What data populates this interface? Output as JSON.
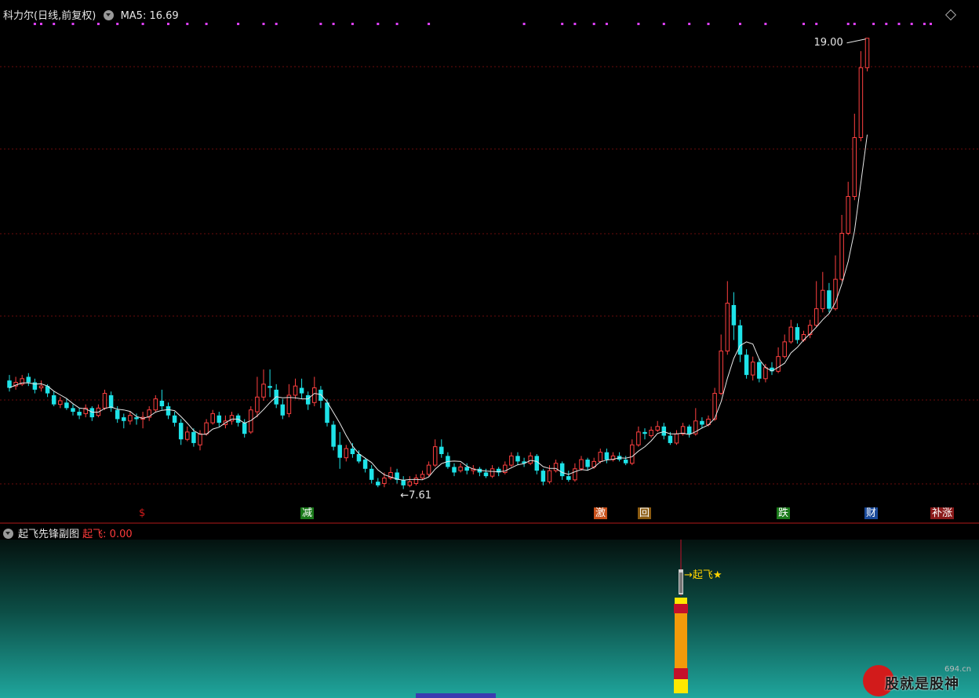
{
  "header": {
    "stock_name": "科力尔(日线,前复权)",
    "ma_label": "MA5: 16.69"
  },
  "sub_header": {
    "title": "起飞先锋副图",
    "value_label": "起飞: 0.00"
  },
  "annotations": {
    "high_label": "19.00",
    "low_label": "←7.61",
    "liftoff_label": "→起飞★"
  },
  "markers": [
    {
      "text": "$",
      "color": "#d21b1b",
      "bg": "#000000"
    },
    {
      "text": "减",
      "color": "#ffffff",
      "bg": "#1a7a1a"
    },
    {
      "text": "激",
      "color": "#ffffff",
      "bg": "#c8501a"
    },
    {
      "text": "回",
      "color": "#ffffff",
      "bg": "#8a5a10"
    },
    {
      "text": "跌",
      "color": "#ffffff",
      "bg": "#1a7a1a"
    },
    {
      "text": "财",
      "color": "#ffffff",
      "bg": "#1a4a9a"
    },
    {
      "text": "补涨",
      "color": "#ffffff",
      "bg": "#8a1a1a"
    }
  ],
  "watermark": {
    "brand": "股就是股神",
    "site": "694.cn"
  },
  "colors": {
    "up": "#ff4040",
    "down": "#1ee3e8",
    "ma": "#e8e8e8",
    "signal_dot": "#e040ff",
    "grid": "#6b0d0d"
  },
  "chart_data": {
    "type": "candlestick",
    "title": "科力尔(日线,前复权)",
    "ylim": [
      6.4,
      19.4
    ],
    "grid": true,
    "highest": 19.0,
    "lowest": 7.61,
    "ma5_last": 16.69,
    "candles": [
      [
        9.7,
        9.5,
        9.85,
        9.4
      ],
      [
        9.55,
        9.65,
        9.8,
        9.45
      ],
      [
        9.6,
        9.75,
        9.85,
        9.55
      ],
      [
        9.8,
        9.65,
        9.9,
        9.55
      ],
      [
        9.65,
        9.45,
        9.75,
        9.35
      ],
      [
        9.5,
        9.55,
        9.7,
        9.4
      ],
      [
        9.55,
        9.35,
        9.6,
        9.25
      ],
      [
        9.3,
        9.05,
        9.4,
        9.0
      ],
      [
        9.05,
        9.15,
        9.25,
        8.95
      ],
      [
        9.1,
        8.95,
        9.2,
        8.9
      ],
      [
        8.95,
        8.85,
        9.05,
        8.75
      ],
      [
        8.85,
        8.75,
        8.95,
        8.65
      ],
      [
        8.8,
        8.95,
        9.05,
        8.7
      ],
      [
        8.95,
        8.7,
        9.0,
        8.6
      ],
      [
        8.75,
        8.95,
        9.05,
        8.7
      ],
      [
        8.95,
        9.35,
        9.45,
        8.9
      ],
      [
        9.3,
        8.95,
        9.4,
        8.85
      ],
      [
        8.9,
        8.65,
        9.0,
        8.55
      ],
      [
        8.7,
        8.6,
        8.8,
        8.4
      ],
      [
        8.6,
        8.75,
        8.85,
        8.5
      ],
      [
        8.7,
        8.65,
        8.8,
        8.5
      ],
      [
        8.65,
        8.7,
        8.85,
        8.4
      ],
      [
        8.7,
        8.9,
        9.0,
        8.6
      ],
      [
        8.9,
        9.2,
        9.3,
        8.85
      ],
      [
        9.15,
        9.0,
        9.45,
        8.9
      ],
      [
        9.0,
        8.75,
        9.1,
        8.65
      ],
      [
        8.75,
        8.55,
        8.85,
        8.45
      ],
      [
        8.55,
        8.1,
        8.65,
        7.95
      ],
      [
        8.1,
        8.3,
        8.45,
        8.05
      ],
      [
        8.3,
        8.0,
        8.4,
        7.9
      ],
      [
        7.95,
        8.25,
        8.35,
        7.8
      ],
      [
        8.25,
        8.55,
        8.65,
        8.2
      ],
      [
        8.55,
        8.8,
        8.9,
        8.5
      ],
      [
        8.75,
        8.55,
        8.85,
        8.45
      ],
      [
        8.5,
        8.6,
        8.75,
        8.4
      ],
      [
        8.6,
        8.75,
        8.85,
        8.5
      ],
      [
        8.75,
        8.55,
        8.8,
        8.45
      ],
      [
        8.55,
        8.25,
        8.65,
        8.15
      ],
      [
        8.3,
        8.9,
        9.0,
        8.25
      ],
      [
        8.85,
        9.25,
        9.8,
        8.7
      ],
      [
        9.25,
        9.6,
        10.0,
        9.15
      ],
      [
        9.55,
        9.5,
        10.0,
        9.25
      ],
      [
        9.45,
        9.05,
        9.6,
        8.95
      ],
      [
        9.05,
        8.75,
        9.2,
        8.65
      ],
      [
        8.8,
        9.3,
        9.6,
        8.7
      ],
      [
        9.3,
        9.55,
        9.75,
        9.2
      ],
      [
        9.5,
        9.35,
        9.75,
        9.2
      ],
      [
        9.3,
        9.05,
        9.4,
        8.9
      ],
      [
        9.1,
        9.5,
        9.8,
        9.0
      ],
      [
        9.45,
        9.15,
        9.55,
        8.95
      ],
      [
        9.1,
        8.55,
        9.2,
        8.45
      ],
      [
        8.5,
        7.9,
        8.6,
        7.8
      ],
      [
        7.95,
        7.6,
        8.3,
        7.3
      ],
      [
        7.6,
        7.85,
        7.95,
        7.5
      ],
      [
        7.85,
        7.7,
        8.0,
        7.6
      ],
      [
        7.7,
        7.5,
        7.8,
        7.45
      ],
      [
        7.55,
        7.3,
        7.6,
        7.2
      ],
      [
        7.3,
        7.0,
        7.4,
        6.9
      ],
      [
        6.95,
        6.85,
        7.05,
        6.8
      ],
      [
        6.9,
        7.05,
        7.2,
        6.8
      ],
      [
        7.05,
        7.2,
        7.35,
        7.0
      ],
      [
        7.2,
        7.0,
        7.3,
        6.9
      ],
      [
        7.0,
        6.85,
        7.1,
        6.75
      ],
      [
        6.85,
        6.95,
        7.1,
        6.8
      ],
      [
        6.9,
        7.05,
        7.15,
        6.85
      ],
      [
        7.05,
        7.15,
        7.25,
        7.0
      ],
      [
        7.15,
        7.4,
        7.5,
        7.1
      ],
      [
        7.4,
        7.9,
        8.1,
        7.35
      ],
      [
        7.9,
        7.7,
        8.1,
        7.6
      ],
      [
        7.65,
        7.35,
        7.75,
        7.3
      ],
      [
        7.35,
        7.2,
        7.45,
        7.1
      ],
      [
        7.25,
        7.35,
        7.45,
        7.2
      ],
      [
        7.35,
        7.25,
        7.45,
        7.15
      ],
      [
        7.25,
        7.3,
        7.4,
        7.15
      ],
      [
        7.3,
        7.2,
        7.35,
        7.1
      ],
      [
        7.2,
        7.1,
        7.3,
        7.05
      ],
      [
        7.1,
        7.3,
        7.4,
        7.05
      ],
      [
        7.3,
        7.2,
        7.35,
        7.1
      ],
      [
        7.2,
        7.4,
        7.5,
        7.15
      ],
      [
        7.4,
        7.65,
        7.75,
        7.35
      ],
      [
        7.65,
        7.5,
        7.75,
        7.4
      ],
      [
        7.5,
        7.45,
        7.6,
        7.35
      ],
      [
        7.45,
        7.65,
        7.75,
        7.4
      ],
      [
        7.65,
        7.25,
        7.7,
        7.15
      ],
      [
        7.25,
        6.95,
        7.3,
        6.85
      ],
      [
        6.95,
        7.25,
        7.4,
        6.9
      ],
      [
        7.25,
        7.45,
        7.55,
        7.2
      ],
      [
        7.45,
        7.1,
        7.5,
        7.0
      ],
      [
        7.1,
        7.0,
        7.25,
        6.95
      ],
      [
        7.0,
        7.3,
        7.45,
        6.95
      ],
      [
        7.3,
        7.55,
        7.65,
        7.25
      ],
      [
        7.55,
        7.35,
        7.6,
        7.25
      ],
      [
        7.35,
        7.5,
        7.6,
        7.3
      ],
      [
        7.5,
        7.75,
        7.85,
        7.45
      ],
      [
        7.75,
        7.55,
        7.85,
        7.45
      ],
      [
        7.55,
        7.65,
        7.75,
        7.5
      ],
      [
        7.65,
        7.55,
        7.75,
        7.5
      ],
      [
        7.55,
        7.45,
        7.65,
        7.4
      ],
      [
        7.45,
        7.95,
        8.1,
        7.4
      ],
      [
        7.95,
        8.3,
        8.45,
        7.9
      ],
      [
        8.3,
        8.25,
        8.4,
        8.1
      ],
      [
        8.2,
        8.35,
        8.45,
        8.15
      ],
      [
        8.35,
        8.45,
        8.6,
        8.3
      ],
      [
        8.45,
        8.2,
        8.55,
        8.1
      ],
      [
        8.2,
        8.0,
        8.3,
        7.95
      ],
      [
        8.0,
        8.25,
        8.35,
        7.95
      ],
      [
        8.25,
        8.45,
        8.55,
        8.2
      ],
      [
        8.45,
        8.25,
        8.5,
        8.15
      ],
      [
        8.25,
        8.6,
        8.95,
        8.2
      ],
      [
        8.6,
        8.5,
        8.7,
        8.4
      ],
      [
        8.5,
        8.65,
        8.75,
        8.45
      ],
      [
        8.65,
        9.35,
        9.5,
        8.6
      ],
      [
        9.35,
        10.5,
        10.95,
        9.3
      ],
      [
        10.5,
        11.8,
        12.4,
        10.4
      ],
      [
        11.75,
        11.2,
        12.1,
        10.8
      ],
      [
        11.2,
        10.4,
        11.35,
        10.2
      ],
      [
        10.4,
        9.85,
        10.55,
        9.75
      ],
      [
        9.85,
        10.2,
        10.35,
        9.7
      ],
      [
        10.2,
        9.75,
        10.3,
        9.65
      ],
      [
        9.75,
        10.05,
        10.15,
        9.65
      ],
      [
        10.05,
        9.95,
        10.2,
        9.85
      ],
      [
        9.95,
        10.35,
        10.6,
        9.9
      ],
      [
        10.35,
        10.75,
        10.95,
        10.3
      ],
      [
        10.75,
        11.15,
        11.35,
        10.7
      ],
      [
        11.15,
        10.8,
        11.25,
        10.7
      ],
      [
        10.8,
        10.95,
        11.05,
        10.75
      ],
      [
        10.95,
        11.2,
        11.35,
        10.85
      ],
      [
        11.2,
        11.65,
        12.4,
        11.15
      ],
      [
        11.65,
        12.15,
        12.65,
        11.55
      ],
      [
        12.15,
        11.65,
        12.35,
        11.55
      ],
      [
        11.65,
        12.45,
        13.1,
        11.6
      ],
      [
        12.45,
        13.7,
        14.2,
        12.4
      ],
      [
        13.7,
        14.7,
        15.1,
        13.65
      ],
      [
        14.7,
        16.3,
        16.95,
        14.6
      ],
      [
        16.3,
        18.2,
        18.65,
        16.2
      ],
      [
        18.2,
        19.0,
        19.0,
        18.1
      ]
    ],
    "signal_dots": [
      4,
      5,
      7,
      10,
      14,
      17,
      21,
      25,
      28,
      31,
      36,
      40,
      42,
      49,
      51,
      54,
      58,
      61,
      66,
      81,
      87,
      89,
      92,
      94,
      99,
      103,
      107,
      110,
      115,
      119,
      125,
      127,
      132,
      133,
      136,
      138,
      140,
      142,
      144,
      145
    ]
  },
  "sub_chart": {
    "name": "起飞",
    "value": 0.0,
    "signal_index": 116
  }
}
